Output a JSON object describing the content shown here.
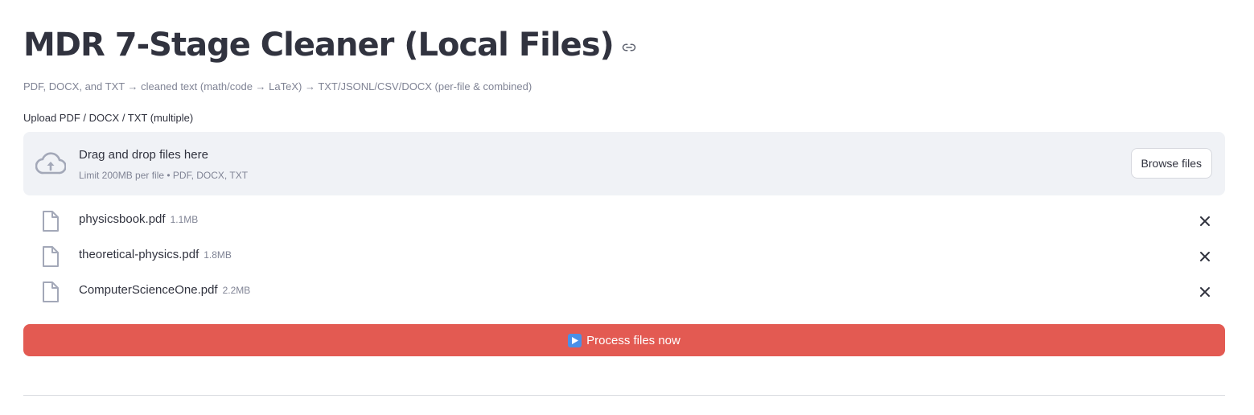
{
  "header": {
    "title": "MDR 7-Stage Cleaner (Local Files)",
    "subtitle": "PDF, DOCX, and TXT → cleaned text (math/code → LaTeX) → TXT/JSONL/CSV/DOCX (per-file & combined)"
  },
  "uploader": {
    "label": "Upload PDF / DOCX / TXT (multiple)",
    "drop_text": "Drag and drop files here",
    "limit_text": "Limit 200MB per file • PDF, DOCX, TXT",
    "browse_label": "Browse files",
    "files": [
      {
        "name": "physicsbook.pdf",
        "size": "1.1MB"
      },
      {
        "name": "theoretical-physics.pdf",
        "size": "1.8MB"
      },
      {
        "name": "ComputerScienceOne.pdf",
        "size": "2.2MB"
      }
    ]
  },
  "actions": {
    "process_label": "Process files now",
    "process_icon": "play-button-icon"
  },
  "colors": {
    "primary": "#e35a52",
    "dropzone_bg": "#f0f2f6",
    "text": "#31333f",
    "muted": "#808495"
  }
}
